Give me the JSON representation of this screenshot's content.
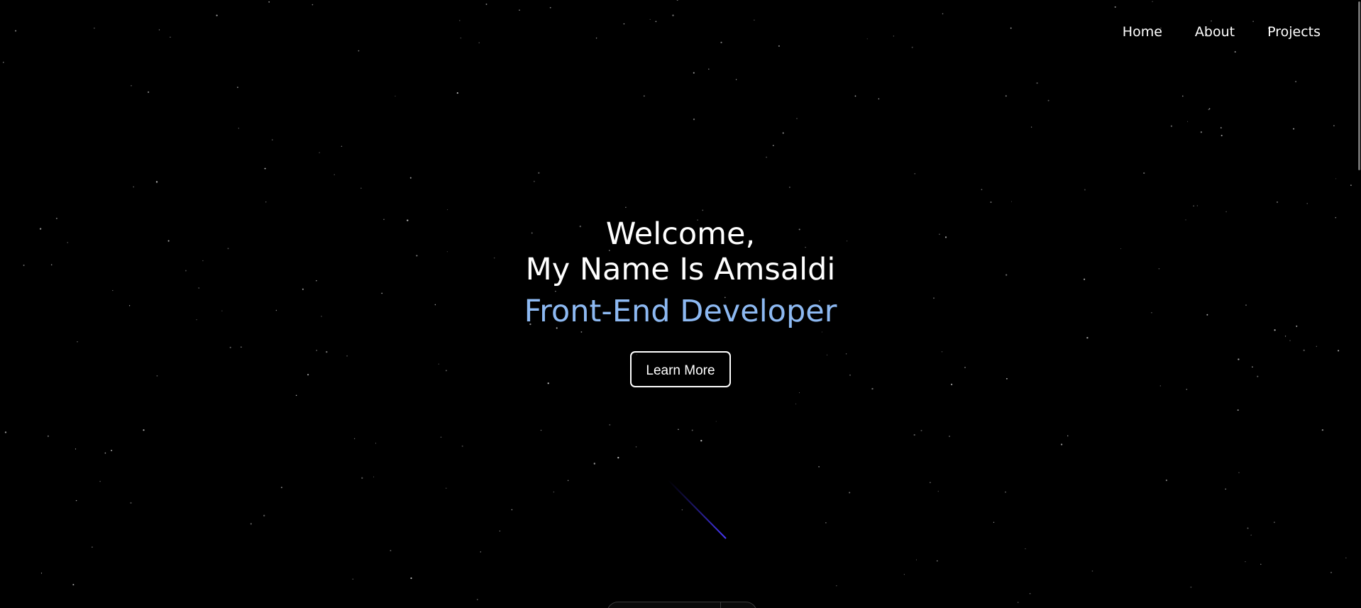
{
  "nav": {
    "items": [
      {
        "label": "Home"
      },
      {
        "label": "About"
      },
      {
        "label": "Projects"
      }
    ]
  },
  "hero": {
    "greeting": "Welcome,",
    "name_line": "My Name Is Amsaldi",
    "role": "Front-End Developer",
    "cta_label": "Learn More"
  },
  "colors": {
    "background": "#000000",
    "text": "#ffffff",
    "accent": "#8db9f2",
    "meteor": "#3a2ad8"
  }
}
